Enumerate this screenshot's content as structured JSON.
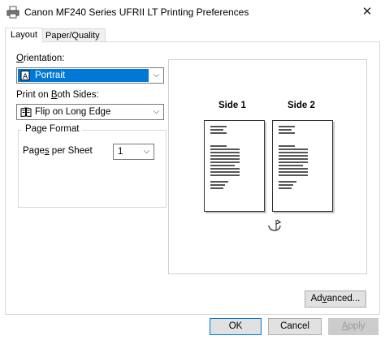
{
  "window": {
    "title": "Canon MF240 Series UFRII LT Printing Preferences",
    "icon": "printer-icon",
    "close_glyph": "✕"
  },
  "tabs": [
    {
      "label": "Layout",
      "active": true
    },
    {
      "label": "Paper/Quality",
      "active": false
    }
  ],
  "orientation": {
    "label_accel": "O",
    "label_rest": "rientation:",
    "value": "Portrait",
    "icon": "portrait-page-icon"
  },
  "duplex": {
    "label_pre": "Print on ",
    "label_accel": "B",
    "label_rest": "oth Sides:",
    "value": "Flip on Long Edge",
    "icon": "book-flip-icon"
  },
  "page_format": {
    "title": "Page Format",
    "pages_per_sheet_pre": "Page",
    "pages_per_sheet_accel": "s",
    "pages_per_sheet_rest": " per Sheet",
    "pages_per_sheet_value": "1"
  },
  "preview": {
    "side1": "Side 1",
    "side2": "Side 2",
    "flip_icon": "rotate-flip-icon"
  },
  "buttons": {
    "advanced_pre": "Ad",
    "advanced_accel": "v",
    "advanced_rest": "anced...",
    "ok": "OK",
    "cancel": "Cancel",
    "apply_accel": "A",
    "apply_rest": "pply"
  },
  "colors": {
    "accent": "#0078d7",
    "button_face": "#e1e1e1",
    "border": "#d9d9d9"
  }
}
